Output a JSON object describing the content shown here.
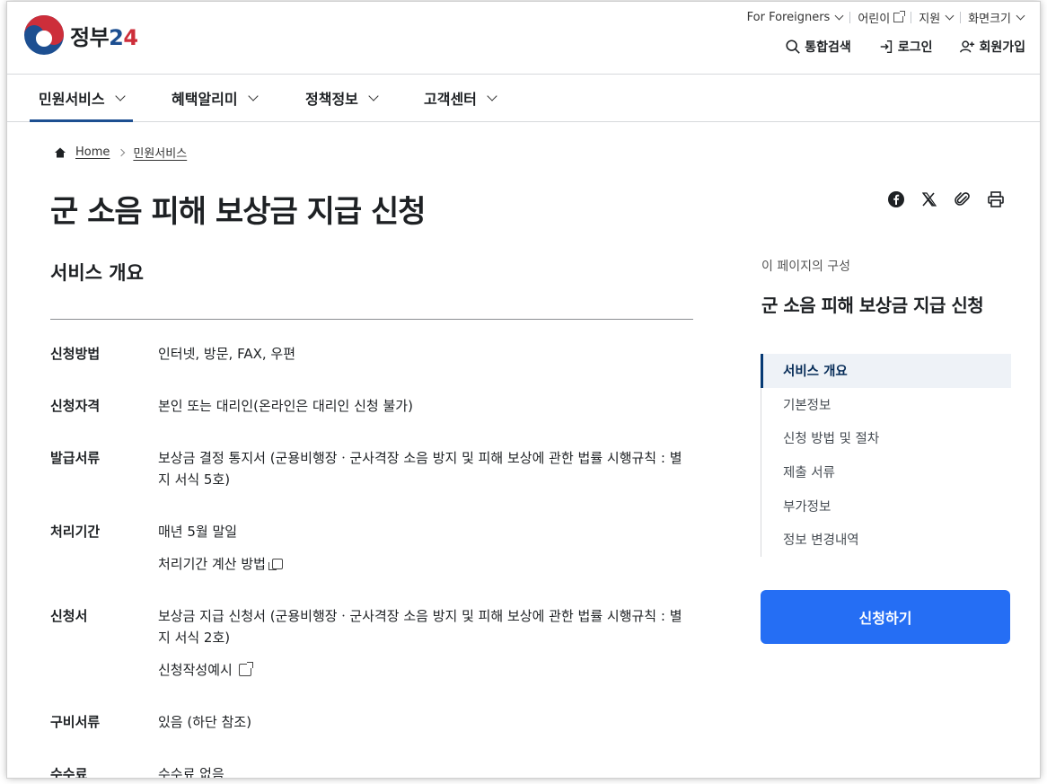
{
  "header": {
    "logo_text_a": "정부",
    "logo_text_b": "2",
    "logo_text_c": "4",
    "util": {
      "foreigners": "For Foreigners",
      "kids": "어린이",
      "support": "지원",
      "zoom": "화면크기"
    },
    "search": "통합검색",
    "login": "로그인",
    "signup": "회원가입"
  },
  "gnb": [
    "민원서비스",
    "혜택알리미",
    "정책정보",
    "고객센터"
  ],
  "breadcrumb": {
    "home": "Home",
    "current": "민원서비스"
  },
  "page_title": "군 소음 피해 보상금 지급 신청",
  "section_title": "서비스 개요",
  "info": {
    "method_label": "신청방법",
    "method_value": "인터넷, 방문, FAX, 우편",
    "qual_label": "신청자격",
    "qual_value": "본인 또는 대리인(온라인은 대리인 신청 불가)",
    "doc_label": "발급서류",
    "doc_value": "보상금 결정 통지서 (군용비행장ㆍ군사격장 소음 방지 및 피해 보상에 관한 법률 시행규칙 : 별지 서식 5호)",
    "period_label": "처리기간",
    "period_value": "매년 5월 말일",
    "period_link": "처리기간 계산 방법",
    "form_label": "신청서",
    "form_value": "보상금 지급 신청서 (군용비행장ㆍ군사격장 소음 방지 및 피해 보상에 관한 법률 시행규칙 : 별지 서식 2호)",
    "form_link": "신청작성예시",
    "req_label": "구비서류",
    "req_value": "있음 (하단 참조)",
    "fee_label": "수수료",
    "fee_value": "수수료 없음"
  },
  "toc": {
    "caption": "이 페이지의 구성",
    "title": "군 소음 피해 보상금 지급 신청",
    "items": [
      "서비스 개요",
      "기본정보",
      "신청 방법 및 절차",
      "제출 서류",
      "부가정보",
      "정보 변경내역"
    ]
  },
  "apply_button": "신청하기",
  "colors": {
    "primary": "#256ef4",
    "navy": "#1d4f91",
    "red": "#cd2e3a"
  }
}
